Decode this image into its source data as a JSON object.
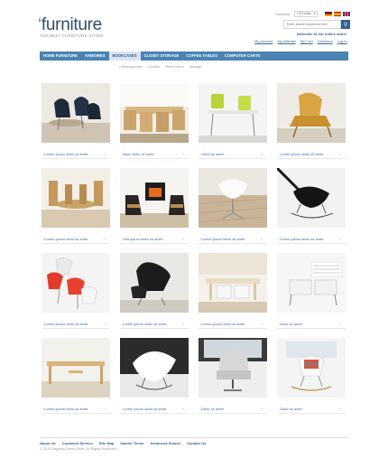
{
  "brand": {
    "logo_mark": "‘",
    "logo_text": "furniture",
    "tagline": "THE BEST FURNITURE STORE"
  },
  "topbar": {
    "currency_label": "Currency:",
    "currency_value": "US Dollar",
    "flags": [
      "de",
      "es",
      "uk"
    ]
  },
  "search": {
    "placeholder": "Enter search keywords here",
    "button_icon": "search-icon"
  },
  "welcome": "Welcome to our online store!",
  "account_links": [
    "My account",
    "My Wishlist",
    "My Cart",
    "Checkout",
    "Log In"
  ],
  "nav": {
    "items": [
      {
        "label": "HOME FURNITURE",
        "active": false
      },
      {
        "label": "ARMOIRES",
        "active": false
      },
      {
        "label": "BOOKCASES",
        "active": true
      },
      {
        "label": "CLOSET STORAGE",
        "active": false
      },
      {
        "label": "COFFEE TABLES",
        "active": false
      },
      {
        "label": "COMPUTER CARTS",
        "active": false
      }
    ]
  },
  "subnav": [
    "Contemporary",
    "Country",
    "Retro Deco",
    "Vintage"
  ],
  "products": [
    {
      "caption": "Lorem ipsum dolor sit amet"
    },
    {
      "caption": "Nunc dolor sit amet"
    },
    {
      "caption": "Dolor sit amet"
    },
    {
      "caption": "Lorem ipsum dolor sit amet"
    },
    {
      "caption": "Lorem ipsum dolor sit amet"
    },
    {
      "caption": "Sed ipsum dolor sit amet"
    },
    {
      "caption": "Lorem ipsum dolor sit amet"
    },
    {
      "caption": "Lorem ipsum dolor sit amet"
    },
    {
      "caption": "Lorem ipsum dolor sit amet"
    },
    {
      "caption": "Lorem ipsum dolor sit amet"
    },
    {
      "caption": "Lorem ipsum dolor sit amet"
    },
    {
      "caption": "Dolor sit amet"
    },
    {
      "caption": "Lorem ipsum dolor sit amet"
    },
    {
      "caption": "Lorem ipsum dolor sit amet"
    },
    {
      "caption": "Dolor sit amet"
    },
    {
      "caption": "Dolor sit amet"
    }
  ],
  "footer": {
    "links": [
      "About Us",
      "Customer Service",
      "Site Map",
      "Search Terms",
      "Advanced Search",
      "Contact Us"
    ],
    "copyright": "© 2010 Magento Demo Store. All Rights Reserved."
  },
  "colors": {
    "nav": "#4a83b4",
    "nav_active_bg": "#d8e4ee",
    "link": "#3a6aa0",
    "brand": "#2f4a6b"
  }
}
